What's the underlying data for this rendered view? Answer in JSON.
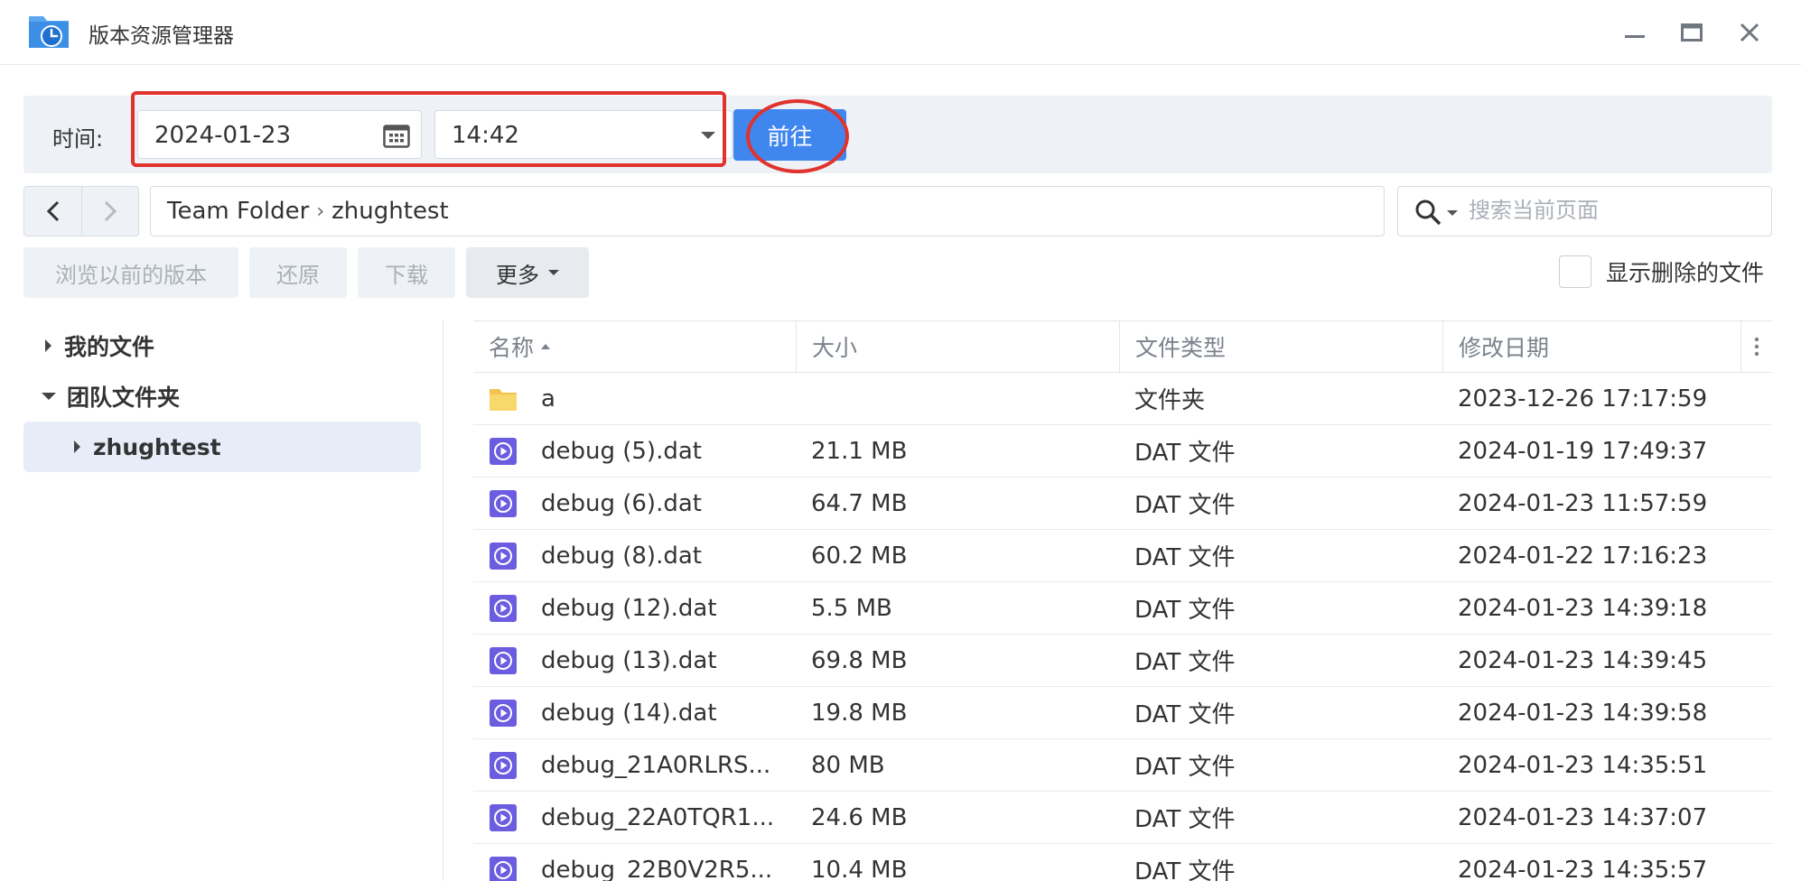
{
  "window": {
    "title": "版本资源管理器",
    "icons": [
      "app-folder-clock-icon",
      "minimize-icon",
      "maximize-icon",
      "close-icon"
    ]
  },
  "timebar": {
    "label": "时间:",
    "date": "2024-01-23",
    "time": "14:42",
    "go_label": "前往",
    "highlight_color": "#e0332e",
    "accent": "#3f86ef"
  },
  "nav": {
    "breadcrumb": [
      "Team Folder",
      "zhughtest"
    ],
    "search_placeholder": "搜索当前页面"
  },
  "toolbar": {
    "browse_prev_label": "浏览以前的版本",
    "restore_label": "还原",
    "download_label": "下载",
    "more_label": "更多",
    "show_deleted_label": "显示删除的文件",
    "show_deleted_checked": false
  },
  "tree": {
    "items": [
      {
        "label": "我的文件",
        "expanded": false
      },
      {
        "label": "团队文件夹",
        "expanded": true
      },
      {
        "label": "zhughtest",
        "expanded": false,
        "selected": true
      }
    ]
  },
  "file_list": {
    "columns": [
      "名称",
      "大小",
      "文件类型",
      "修改日期"
    ],
    "sort_column": "名称",
    "rows": [
      {
        "name": "a",
        "size": "",
        "type": "文件夹",
        "modified": "2023-12-26 17:17:59",
        "icon": "folder-icon"
      },
      {
        "name": "debug (5).dat",
        "size": "21.1 MB",
        "type": "DAT 文件",
        "modified": "2024-01-19 17:49:37",
        "icon": "media-file-icon"
      },
      {
        "name": "debug (6).dat",
        "size": "64.7 MB",
        "type": "DAT 文件",
        "modified": "2024-01-23 11:57:59",
        "icon": "media-file-icon"
      },
      {
        "name": "debug (8).dat",
        "size": "60.2 MB",
        "type": "DAT 文件",
        "modified": "2024-01-22 17:16:23",
        "icon": "media-file-icon"
      },
      {
        "name": "debug (12).dat",
        "size": "5.5 MB",
        "type": "DAT 文件",
        "modified": "2024-01-23 14:39:18",
        "icon": "media-file-icon"
      },
      {
        "name": "debug (13).dat",
        "size": "69.8 MB",
        "type": "DAT 文件",
        "modified": "2024-01-23 14:39:45",
        "icon": "media-file-icon"
      },
      {
        "name": "debug (14).dat",
        "size": "19.8 MB",
        "type": "DAT 文件",
        "modified": "2024-01-23 14:39:58",
        "icon": "media-file-icon"
      },
      {
        "name": "debug_21A0RLRS...",
        "size": "80 MB",
        "type": "DAT 文件",
        "modified": "2024-01-23 14:35:51",
        "icon": "media-file-icon"
      },
      {
        "name": "debug_22A0TQR1...",
        "size": "24.6 MB",
        "type": "DAT 文件",
        "modified": "2024-01-23 14:37:07",
        "icon": "media-file-icon"
      },
      {
        "name": "debug_22B0V2R5...",
        "size": "10.4 MB",
        "type": "DAT 文件",
        "modified": "2024-01-23 14:35:57",
        "icon": "media-file-icon"
      }
    ]
  }
}
